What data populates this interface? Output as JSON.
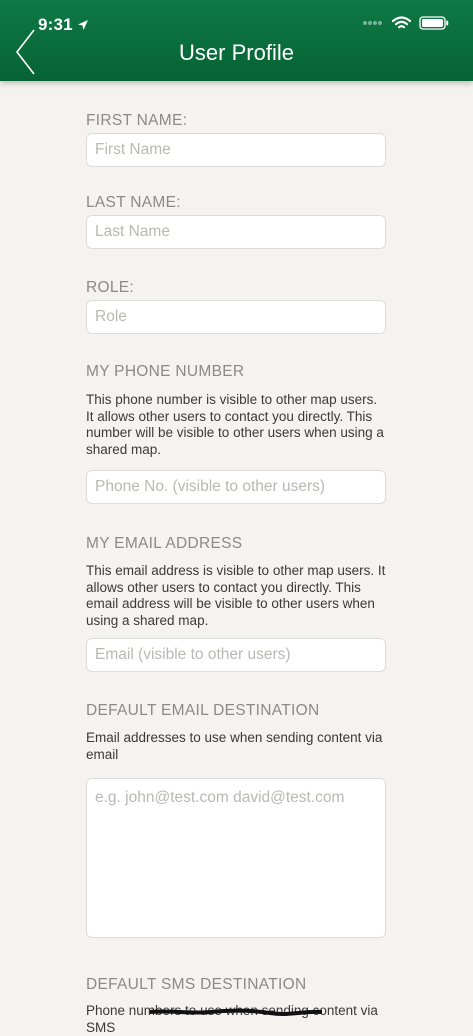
{
  "status_bar": {
    "time": "9:31"
  },
  "nav": {
    "title": "User Profile"
  },
  "form": {
    "first_name": {
      "label": "FIRST NAME:",
      "placeholder": "First Name"
    },
    "last_name": {
      "label": "LAST NAME:",
      "placeholder": "Last Name"
    },
    "role": {
      "label": "ROLE:",
      "placeholder": "Role"
    },
    "phone": {
      "label": "MY PHONE NUMBER",
      "description": "This phone number is visible to other map users. It allows other users to contact you directly. This number will be visible to other users when using a shared map.",
      "placeholder": "Phone No. (visible to other users)"
    },
    "email": {
      "label": "MY EMAIL ADDRESS",
      "description": "This email address is visible to other map users. It allows other users to contact you directly. This email address will be visible to other users when using a shared map.",
      "placeholder": "Email (visible to other users)"
    },
    "default_email": {
      "label": "DEFAULT EMAIL DESTINATION",
      "description": "Email addresses to use when sending content via email",
      "placeholder": "e.g. john@test.com david@test.com"
    },
    "default_sms": {
      "label": "DEFAULT SMS DESTINATION",
      "description": "Phone numbers to use when sending content via SMS"
    }
  },
  "icons": {
    "back": "chevron-left-icon",
    "location": "location-arrow-icon",
    "signal": "signal-dots-icon",
    "wifi": "wifi-icon",
    "battery": "battery-icon"
  },
  "colors": {
    "header": "#0a6e3c",
    "background": "#f4f3ef",
    "label": "#8a8a86",
    "placeholder": "#b8b8b4"
  }
}
